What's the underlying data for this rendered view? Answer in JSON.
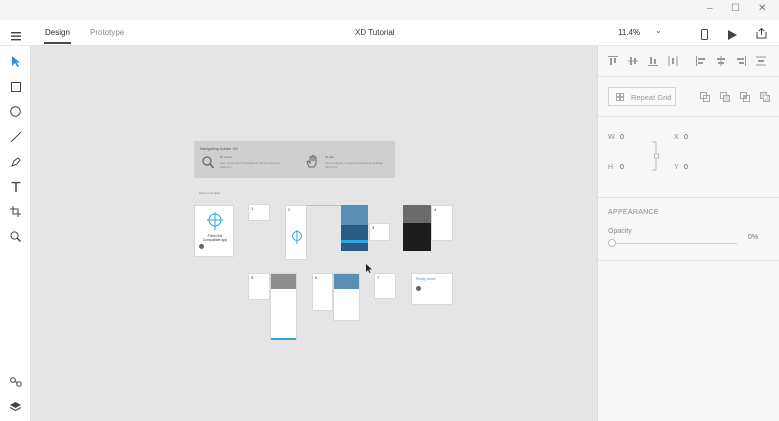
{
  "tabs": {
    "design": "Design",
    "prototype": "Prototype"
  },
  "document_title": "XD Tutorial",
  "zoom": "11.4%",
  "panel": {
    "repeat_grid": "Repeat Grid",
    "w_label": "W",
    "w_value": "0",
    "x_label": "X",
    "x_value": "0",
    "h_label": "H",
    "h_value": "0",
    "y_label": "Y",
    "y_value": "0",
    "appearance": "APPEARANCE",
    "opacity_label": "Opacity",
    "opacity_value": "0%"
  },
  "canvas": {
    "tip_title": "Navigating Adobe XD",
    "tip_zoom_title": "To zoom:",
    "tip_zoom_text": "Your finger pinch trackpad or ctrl to zoom to a selection",
    "tip_pan_title": "To pan:",
    "tip_pan_text": "Use trackpad, or press spacebar to activate hand tool",
    "zoom_hint": "Zoom in to start",
    "card_title": "Fresh the Compatible app",
    "ready_title": "Ready done!",
    "artboard_numbers": [
      "1",
      "2",
      "3",
      "4",
      "5",
      "6",
      "7"
    ]
  },
  "colors": {
    "accent": "#2aa6e0",
    "dark": "#1c1c1c",
    "photo_blue": "#5a8fb5"
  }
}
